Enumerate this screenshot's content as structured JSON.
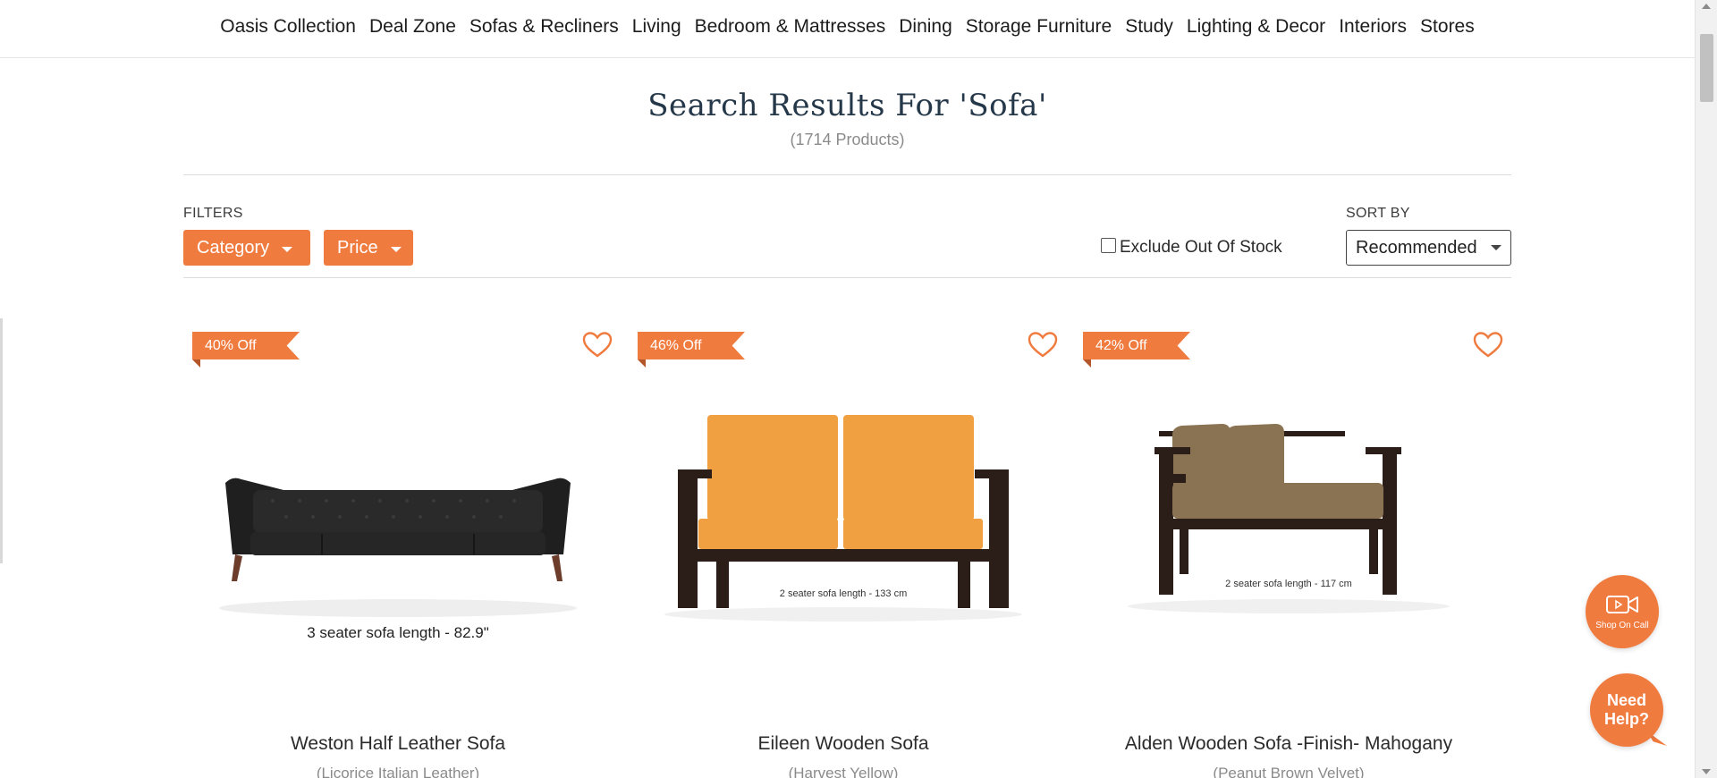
{
  "nav": {
    "items": [
      "Oasis Collection",
      "Deal Zone",
      "Sofas & Recliners",
      "Living",
      "Bedroom & Mattresses",
      "Dining",
      "Storage Furniture",
      "Study",
      "Lighting & Decor",
      "Interiors",
      "Stores"
    ]
  },
  "search": {
    "title": "Search Results For 'Sofa'",
    "count": "(1714 Products)"
  },
  "filters": {
    "label": "FILTERS",
    "category_label": "Category",
    "price_label": "Price",
    "exclude_label": "Exclude Out Of Stock",
    "exclude_checked": false
  },
  "sort": {
    "label": "SORT BY",
    "selected": "Recommended"
  },
  "products": [
    {
      "discount": "40% Off",
      "name": "Weston Half Leather Sofa",
      "variant": "(Licorice Italian Leather)",
      "caption": "3 seater sofa length - 82.9\"",
      "color": "#1f1f1f"
    },
    {
      "discount": "46% Off",
      "name": "Eileen Wooden Sofa",
      "variant": "(Harvest Yellow)",
      "caption": "2 seater sofa length - 133 cm",
      "color": "#f0a040"
    },
    {
      "discount": "42% Off",
      "name": "Alden Wooden Sofa -Finish- Mahogany",
      "variant": "(Peanut Brown Velvet)",
      "caption": "2 seater sofa length - 117 cm",
      "color": "#8a7352"
    }
  ],
  "widgets": {
    "shop_on_call": "Shop On Call",
    "need_help": "Need Help?"
  },
  "colors": {
    "accent": "#f07b3f",
    "title": "#25384a"
  }
}
